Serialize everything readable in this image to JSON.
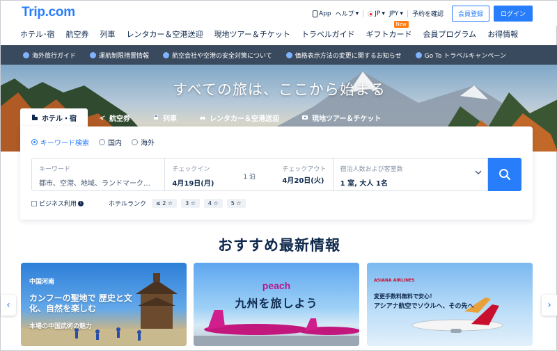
{
  "brand": {
    "logo": "Trip.com"
  },
  "topbar": {
    "app": "App",
    "help": "ヘルプ",
    "region": "JP",
    "currency": "JPY",
    "booking_check": "予約を確認",
    "register": "会員登録",
    "login": "ログイン"
  },
  "nav": {
    "items": [
      "ホテル･宿",
      "航空券",
      "列車",
      "レンタカー＆空港送迎",
      "現地ツアー＆チケット",
      "トラベルガイド",
      "ギフトカード",
      "会員プログラム",
      "お得情報"
    ],
    "new_badge": "New"
  },
  "notices": [
    "海外旅行ガイド",
    "運航制限措置情報",
    "航空会社や空港の安全対策について",
    "価格表示方法の変更に関するお知らせ",
    "Go To トラベルキャンペーン"
  ],
  "hero": {
    "title": "すべての旅は、ここから始まる"
  },
  "tabs": [
    "ホテル・宿",
    "航空券",
    "列車",
    "レンタカー＆空港送迎",
    "現地ツアー＆チケット"
  ],
  "search": {
    "radios": [
      "キーワード検索",
      "国内",
      "海外"
    ],
    "keyword_label": "キーワード",
    "keyword_placeholder": "都市、空港、地域、ランドマーク…",
    "checkin_label": "チェックイン",
    "checkin_value": "4月19日(月)",
    "nights": "1 泊",
    "checkout_label": "チェックアウト",
    "checkout_value": "4月20日(火)",
    "guests_label": "宿泊人数および客室数",
    "guests_value": "1 室, 大人 1名",
    "business": "ビジネス利用",
    "rank_label": "ホテルランク",
    "ranks": [
      "≤ 2 ☆",
      "3 ☆",
      "4 ☆",
      "5 ☆"
    ]
  },
  "section": {
    "title": "おすすめ最新情報"
  },
  "promos": [
    {
      "tag": "中国河南",
      "headline": "カンフーの聖地で 歴史と文化、自然を楽しむ",
      "sub": "本場の中国武術の魅力"
    },
    {
      "brand": "peach",
      "headline": "九州を旅しよう"
    },
    {
      "brand": "ASIANA AIRLINES",
      "line1": "変更手数料無料で安心！",
      "line2": "アシアナ航空でソウルへ、その先へ"
    }
  ],
  "colors": {
    "accent": "#287dfa",
    "dark": "#0f294d",
    "notice_bg": "#3a4a5e",
    "new_badge": "#ff7d13"
  }
}
